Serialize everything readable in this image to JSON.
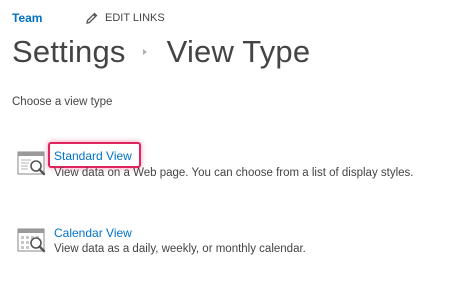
{
  "topbar": {
    "site_title": "Team",
    "edit_links_label": "EDIT LINKS"
  },
  "breadcrumb": {
    "parent": "Settings",
    "current": "View Type"
  },
  "prompt": "Choose a view type",
  "options": [
    {
      "label": "Standard View",
      "description": "View data on a Web page. You can choose from a list of display styles.",
      "icon": "standard-view-icon",
      "highlighted": true
    },
    {
      "label": "Calendar View",
      "description": "View data as a daily, weekly, or monthly calendar.",
      "icon": "calendar-view-icon",
      "highlighted": false
    }
  ],
  "colors": {
    "link": "#0072c6",
    "text": "#444444",
    "highlight": "#e0245e"
  }
}
